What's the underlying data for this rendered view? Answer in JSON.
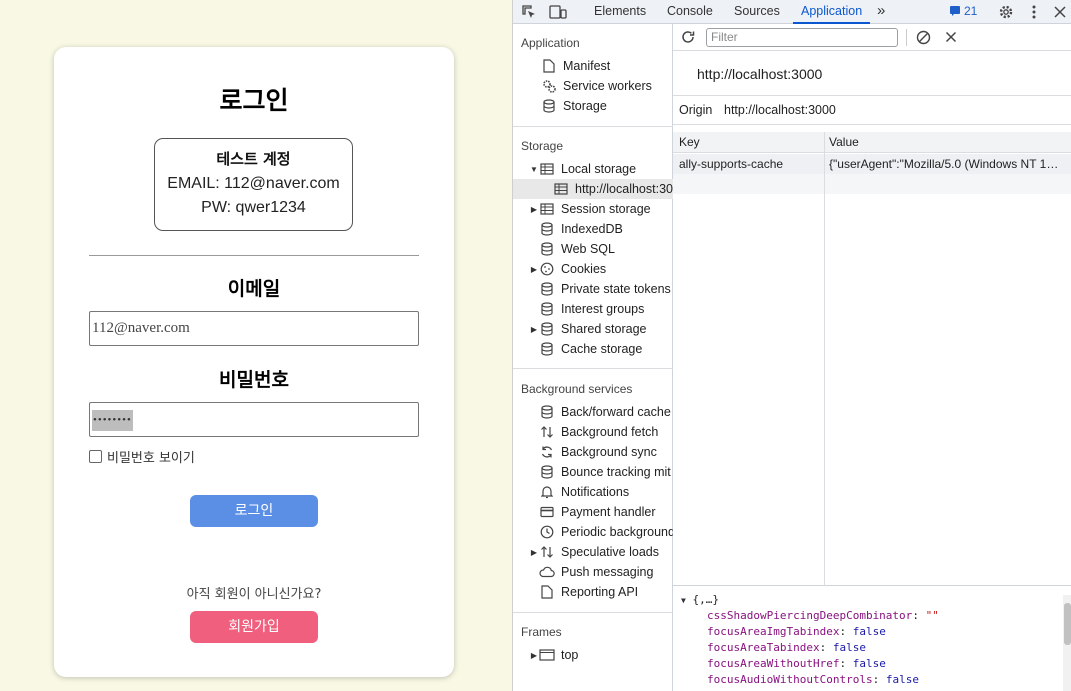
{
  "login": {
    "title": "로그인",
    "test_account": {
      "title": "테스트 계정",
      "email_line": "EMAIL: 112@naver.com",
      "pw_line": "PW: qwer1234"
    },
    "email_label": "이메일",
    "email_value": "112@naver.com",
    "password_label": "비밀번호",
    "password_mask": "••••••••",
    "show_password_label": "비밀번호 보이기",
    "login_button": "로그인",
    "signup_prompt": "아직 회원이 아니신가요?",
    "signup_button": "회원가입"
  },
  "devtools": {
    "tabs": [
      "Elements",
      "Console",
      "Sources",
      "Application"
    ],
    "active_tab": "Application",
    "more_tabs": "»",
    "issues_count": "21",
    "sidebar": {
      "application_header": "Application",
      "application_items": [
        "Manifest",
        "Service workers",
        "Storage"
      ],
      "storage_header": "Storage",
      "storage_items": [
        "Local storage",
        "http://localhost:30",
        "Session storage",
        "IndexedDB",
        "Web SQL",
        "Cookies",
        "Private state tokens",
        "Interest groups",
        "Shared storage",
        "Cache storage"
      ],
      "background_header": "Background services",
      "background_items": [
        "Back/forward cache",
        "Background fetch",
        "Background sync",
        "Bounce tracking mit",
        "Notifications",
        "Payment handler",
        "Periodic background",
        "Speculative loads",
        "Push messaging",
        "Reporting API"
      ],
      "frames_header": "Frames",
      "frames_items": [
        "top"
      ]
    },
    "filter_placeholder": "Filter",
    "origin_url": "http://localhost:3000",
    "origin_label": "Origin",
    "origin_value": "http://localhost:3000",
    "table": {
      "headers": [
        "Key",
        "Value"
      ],
      "rows": [
        {
          "key": "ally-supports-cache",
          "value": "{\"userAgent\":\"Mozilla/5.0 (Windows NT 1…"
        }
      ]
    },
    "preview": {
      "root": "{,…}",
      "entries": [
        {
          "key": "cssShadowPiercingDeepCombinator",
          "value": "\"\""
        },
        {
          "key": "focusAreaImgTabindex",
          "value": "false"
        },
        {
          "key": "focusAreaTabindex",
          "value": "false"
        },
        {
          "key": "focusAreaWithoutHref",
          "value": "false"
        },
        {
          "key": "focusAudioWithoutControls",
          "value": "false"
        }
      ]
    },
    "colors": {
      "accent": "#0b57d0",
      "login_button": "#5b8fe6",
      "signup_button": "#f0607e"
    }
  }
}
